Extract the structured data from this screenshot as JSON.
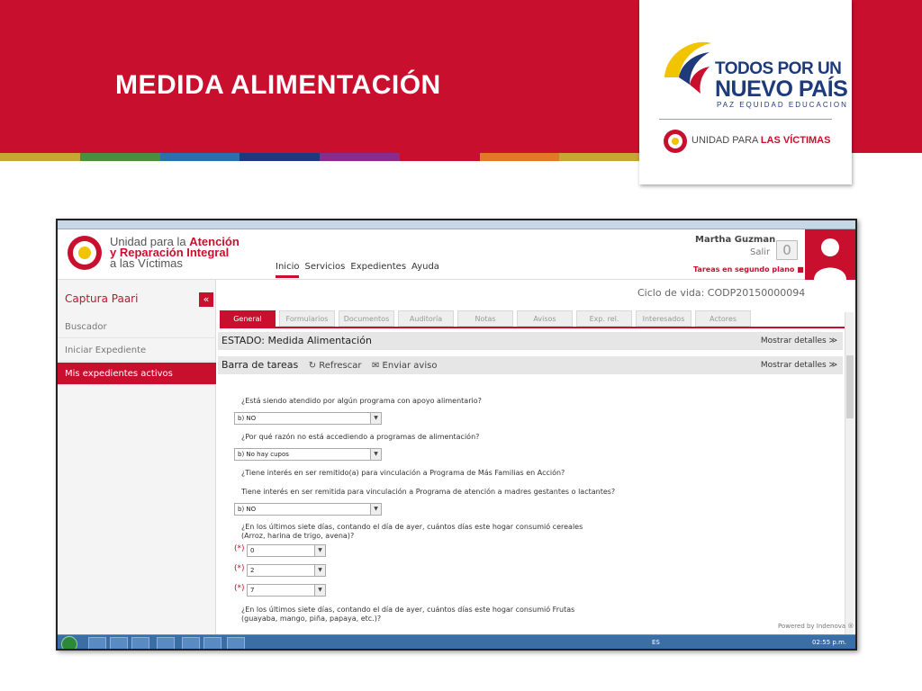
{
  "slide": {
    "title": "MEDIDA ALIMENTACIÓN",
    "strip_colors": [
      "#c8a534",
      "#4a8f3c",
      "#2d6fa8",
      "#1e3a7b",
      "#8a2d8a",
      "#c8102e",
      "#e07a2a",
      "#c8a534"
    ]
  },
  "logo": {
    "line1": "TODOS POR UN",
    "line2": "NUEVO PAÍS",
    "line3": "PAZ  EQUIDAD  EDUCACION",
    "unit_prefix": "UNIDAD PARA",
    "unit_bold": "LAS VÍCTIMAS"
  },
  "app": {
    "org_line1_a": "Unidad para la",
    "org_line1_b": "Atención",
    "org_line2": "y Reparación Integral",
    "org_line3": "a las Víctimas",
    "nav": [
      "Inicio",
      "Servicios",
      "Expedientes",
      "Ayuda"
    ],
    "user": "Martha Guzman",
    "logout": "Salir",
    "count": "0",
    "bg_tasks": "Tareas en segundo plano"
  },
  "sidebar": {
    "title": "Captura Paari",
    "collapse": "«",
    "items": [
      "Buscador",
      "Iniciar Expediente",
      "Mis expedientes activos"
    ]
  },
  "content": {
    "lifecycle": "Ciclo de vida: CODP20150000094",
    "tabs": [
      "General",
      "Formularios",
      "Documentos",
      "Auditoría",
      "Notas",
      "Avisos",
      "Exp. rel.",
      "Interesados",
      "Actores"
    ],
    "status": "ESTADO: Medida Alimentación",
    "details": "Mostrar detalles",
    "tasks_label": "Barra de tareas",
    "refresh": "Refrescar",
    "send": "Enviar aviso",
    "questions": [
      "¿Está siendo atendido por algún programa con apoyo alimentario?",
      "¿Por qué razón no está accediendo a programas de alimentación?",
      "¿Tiene interés en ser remitido(a) para vinculación a Programa de Más Familias en Acción?",
      "Tiene interés en ser remitida para vinculación a Programa de atención a madres gestantes o lactantes?",
      "¿En los últimos siete días, contando el día de ayer, cuántos días este hogar consumió cereales",
      "(Arroz, harina de trigo, avena)?",
      "¿En los últimos siete días, contando el día de ayer, cuántos días este hogar consumió Frutas",
      "(guayaba, mango, piña, papaya, etc.)?"
    ],
    "answers": [
      "b) NO",
      "b) No hay cupos",
      "b) NO",
      "0",
      "2",
      "7"
    ],
    "required": "(*)",
    "powered": "Powered by Indenova ®"
  },
  "taskbar": {
    "lang": "ES",
    "clock": "02:55 p.m."
  }
}
